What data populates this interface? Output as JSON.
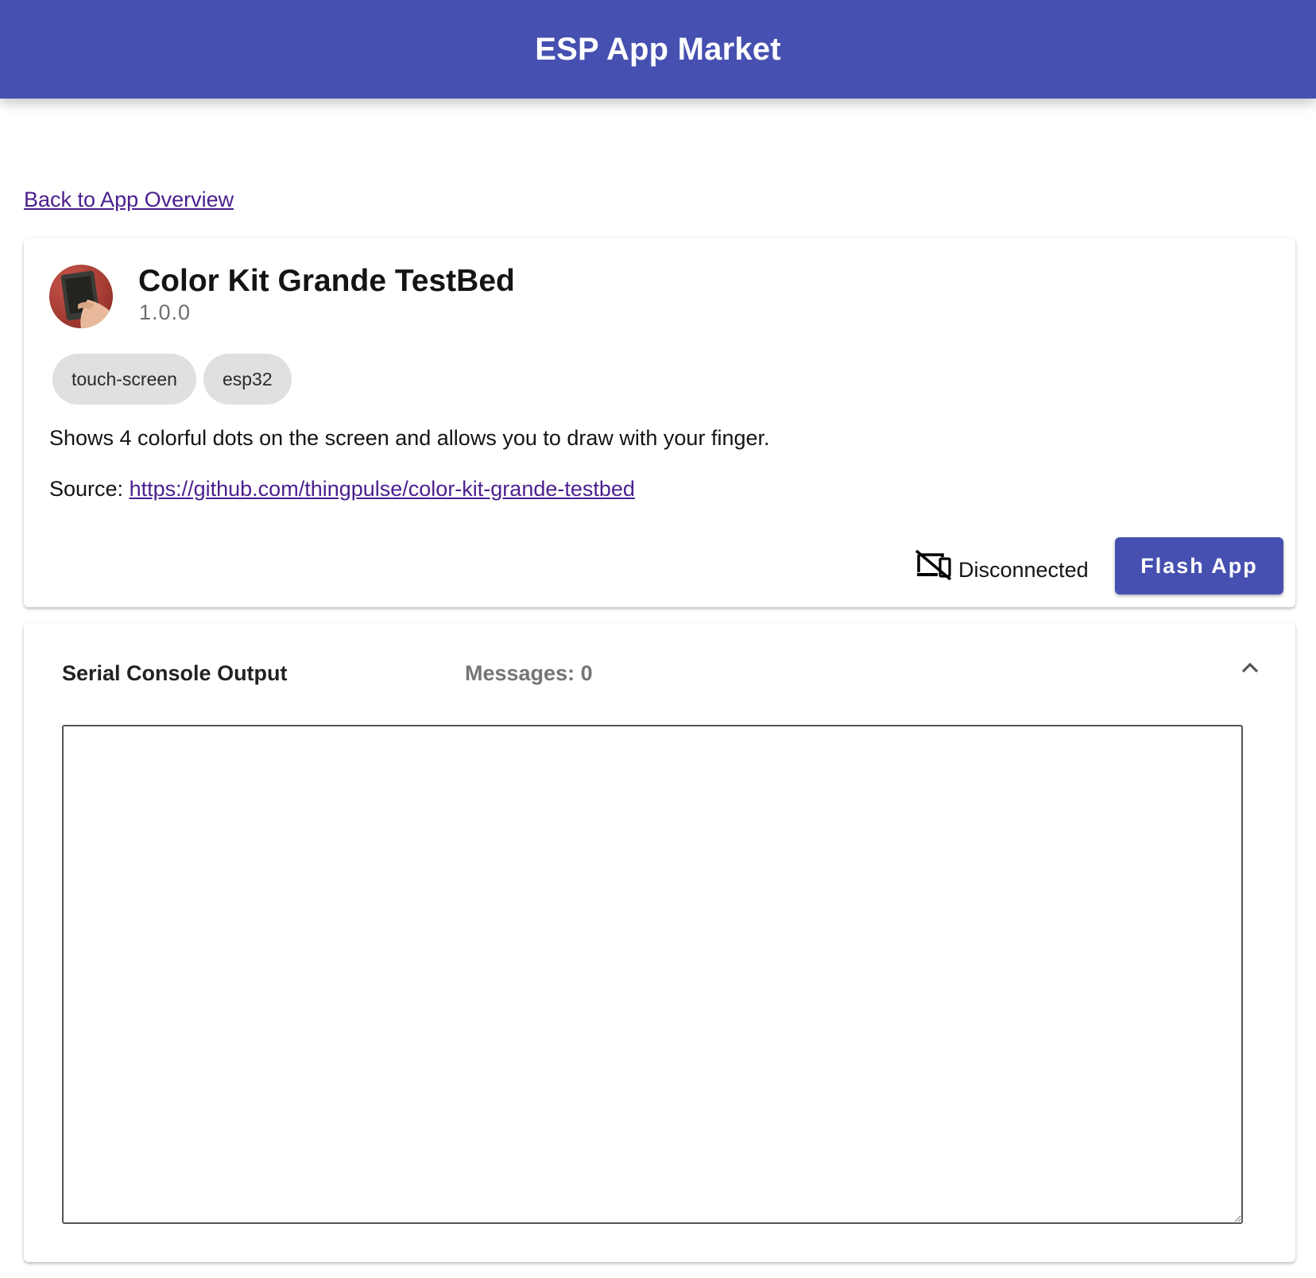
{
  "header": {
    "title": "ESP App Market"
  },
  "back_link": {
    "label": "Back to App Overview"
  },
  "app": {
    "name": "Color Kit Grande TestBed",
    "version": "1.0.0",
    "tags": [
      "touch-screen",
      "esp32"
    ],
    "description": "Shows 4 colorful dots on the screen and allows you to draw with your finger.",
    "source_label": "Source:",
    "source_url": "https://github.com/thingpulse/color-kit-grande-testbed",
    "status": "Disconnected",
    "status_icon": "devices-off-icon",
    "flash_button_label": "Flash App"
  },
  "console": {
    "title": "Serial Console Output",
    "messages_label": "Messages: 0",
    "collapse_icon": "chevron-up-icon",
    "output": ""
  },
  "colors": {
    "primary": "#4650b0",
    "link": "#4a1f8f",
    "chip_bg": "#e0e0e0",
    "muted_text": "#757575"
  }
}
